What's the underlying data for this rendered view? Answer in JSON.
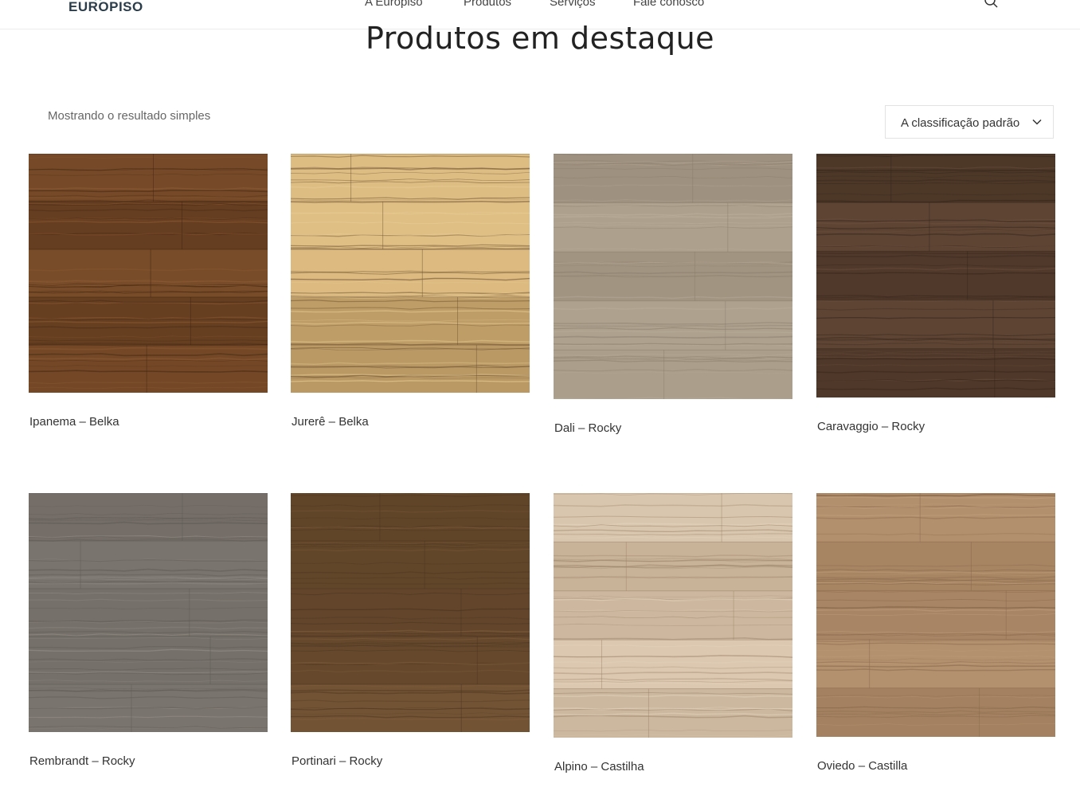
{
  "header": {
    "logo_text": "EUROPISO",
    "nav": [
      {
        "label": "A Europiso"
      },
      {
        "label": "Produtos"
      },
      {
        "label": "Serviços"
      },
      {
        "label": "Fale conosco"
      }
    ]
  },
  "main": {
    "title": "Produtos em destaque",
    "result_count": "Mostrando o resultado simples",
    "sort": {
      "selected": "A classificação padrão"
    },
    "products": [
      {
        "name": "Ipanema – Belka",
        "colors": {
          "base": "#6e4424",
          "dark": "#3e2410",
          "light": "#8d5b33"
        }
      },
      {
        "name": "Jurerê – Belka",
        "colors": {
          "base": "#d9b67a",
          "dark": "#6b5030",
          "light": "#ecd29a"
        }
      },
      {
        "name": "Dali – Rocky",
        "colors": {
          "base": "#a89b88",
          "dark": "#8a7c6a",
          "light": "#bdb19d"
        }
      },
      {
        "name": "Caravaggio – Rocky",
        "colors": {
          "base": "#5a4130",
          "dark": "#33241a",
          "light": "#6e5240"
        }
      },
      {
        "name": "Rembrandt – Rocky",
        "colors": {
          "base": "#807a74",
          "dark": "#5d5852",
          "light": "#97918b"
        }
      },
      {
        "name": "Portinari – Rocky",
        "colors": {
          "base": "#6d4f31",
          "dark": "#4a331e",
          "light": "#82603d"
        }
      },
      {
        "name": "Alpino – Castilha",
        "colors": {
          "base": "#d7c3aa",
          "dark": "#9a8268",
          "light": "#e7d7c2"
        }
      },
      {
        "name": "Oviedo – Castilla",
        "colors": {
          "base": "#b08d6a",
          "dark": "#86674a",
          "light": "#c4a281"
        }
      }
    ]
  }
}
